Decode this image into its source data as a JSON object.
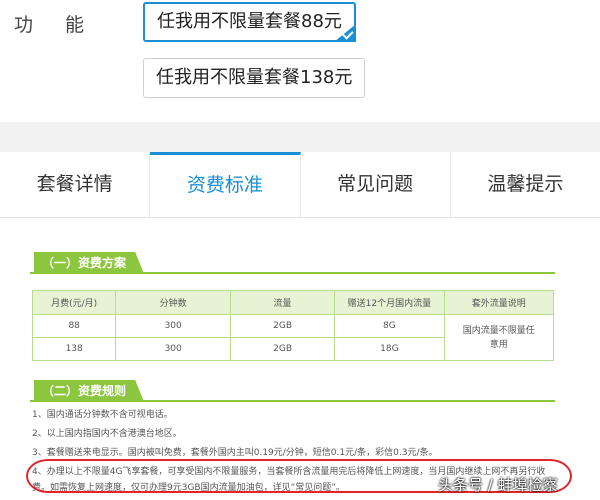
{
  "function_label": "功能",
  "options": [
    {
      "label": "任我用不限量套餐88元",
      "selected": true
    },
    {
      "label": "任我用不限量套餐138元",
      "selected": false
    }
  ],
  "tabs": [
    "套餐详情",
    "资费标准",
    "常见问题",
    "温馨提示"
  ],
  "active_tab": "资费标准",
  "section1": "（一）资费方案",
  "table": {
    "headers": [
      "月费(元/月)",
      "分钟数",
      "流量",
      "赠送12个月国内流量",
      "套外流量说明"
    ],
    "rows": [
      [
        "88",
        "300",
        "2GB",
        "8G"
      ],
      [
        "138",
        "300",
        "2GB",
        "18G"
      ]
    ],
    "overflow_note": "国内流量不限量任意用"
  },
  "section2": "（二）资费规则",
  "rules": [
    "1、国内通话分钟数不含可视电话。",
    "2、以上国内指国内不含港澳台地区。",
    "3、套餐赠送来电显示。国内被叫免费，套餐外国内主叫0.19元/分钟，短信0.1元/条，彩信0.3元/条。",
    "4、办理以上不限量4G飞享套餐，可享受国内不限量服务，当套餐所含流量用完后将降低上网速度，当月国内继续上网不再另行收",
    "费。如需恢复上网速度，仅可办理9元3GB国内流量加油包，详见“常见问题”。"
  ],
  "watermark": "头条号 / 蚌埠检察",
  "colors": {
    "accent": "#1a8fd6",
    "green": "#8cc63f",
    "highlight": "#e0262b"
  }
}
